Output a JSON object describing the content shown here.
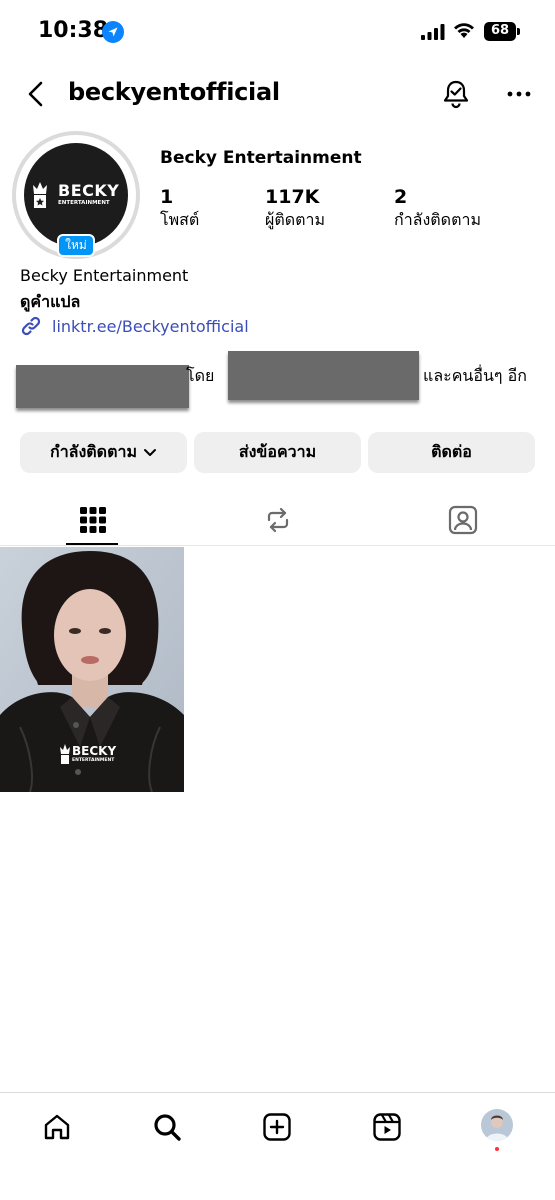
{
  "status_bar": {
    "time": "10:38",
    "battery": "68"
  },
  "header": {
    "username": "beckyentofficial"
  },
  "profile": {
    "display_name": "Becky Entertainment",
    "avatar_logo_line1": "BECKY",
    "avatar_logo_line2": "ENTERTAINMENT",
    "new_badge": "ใหม่",
    "stats": [
      {
        "value": "1",
        "label": "โพสต์"
      },
      {
        "value": "117K",
        "label": "ผู้ติดตาม"
      },
      {
        "value": "2",
        "label": "กำลังติดตาม"
      }
    ],
    "bio_name": "Becky Entertainment",
    "translate": "ดูคำแปล",
    "link": "linktr.ee/Beckyentofficial",
    "followed_by_text1": "โดย",
    "followed_by_text2": "และคนอื่นๆ อีก"
  },
  "actions": {
    "following": "กำลังติดตาม",
    "message": "ส่งข้อความ",
    "contact": "ติดต่อ"
  },
  "tabs": [
    "grid-icon",
    "reposts-icon",
    "tagged-icon"
  ],
  "posts": [
    {
      "logo_line1": "BECKY",
      "logo_line2": "ENTERTAINMENT"
    }
  ],
  "bottom_nav": [
    "home-icon",
    "search-icon",
    "create-icon",
    "reels-icon",
    "profile-avatar"
  ],
  "colors": {
    "accent": "#0095f6",
    "link": "#3b4db8",
    "button_bg": "#efefef"
  }
}
